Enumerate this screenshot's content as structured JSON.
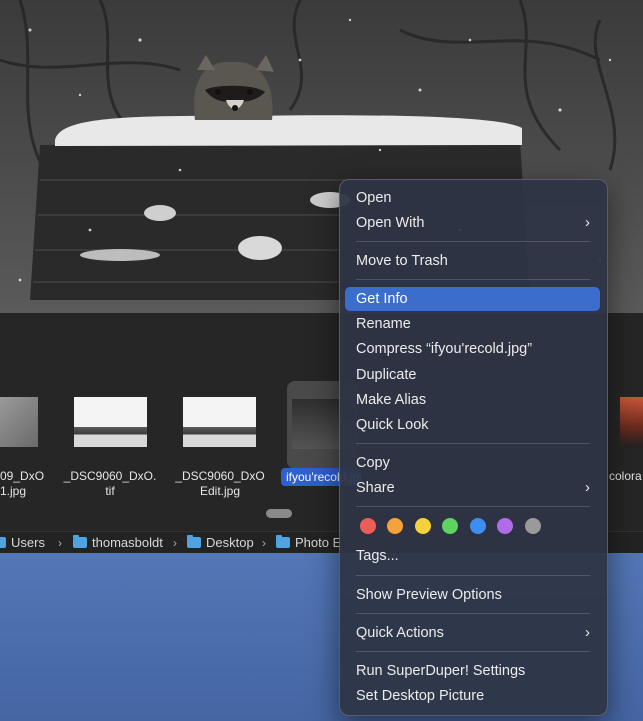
{
  "files": [
    {
      "name": "09_DxO\n1.jpg"
    },
    {
      "name": "_DSC9060_DxO.\ntif"
    },
    {
      "name": "_DSC9060_DxO\nEdit.jpg"
    },
    {
      "name": "ifyou'recold.jpg"
    },
    {
      "name": "colora"
    }
  ],
  "path_bar": [
    "Users",
    "thomasboldt",
    "Desktop",
    "Photo E"
  ],
  "context_menu": {
    "items": [
      {
        "label": "Open"
      },
      {
        "label": "Open With",
        "submenu": true
      },
      {
        "label": "Move to Trash"
      },
      {
        "label": "Get Info",
        "highlighted": true
      },
      {
        "label": "Rename"
      },
      {
        "label": "Compress “ifyou'recold.jpg”"
      },
      {
        "label": "Duplicate"
      },
      {
        "label": "Make Alias"
      },
      {
        "label": "Quick Look"
      },
      {
        "label": "Copy"
      },
      {
        "label": "Share",
        "submenu": true
      },
      {
        "label": "Tags..."
      },
      {
        "label": "Show Preview Options"
      },
      {
        "label": "Quick Actions",
        "submenu": true
      },
      {
        "label": "Run SuperDuper! Settings"
      },
      {
        "label": "Set Desktop Picture"
      }
    ],
    "tag_colors": [
      "#ee5e58",
      "#f5a23c",
      "#f4d13d",
      "#5fd35f",
      "#3d8ef0",
      "#b06be8",
      "#9a9a9a"
    ],
    "highlight_color": "#3a6dcc"
  },
  "icons": {
    "chevron": "chevron-right-icon",
    "folder": "folder-icon"
  }
}
